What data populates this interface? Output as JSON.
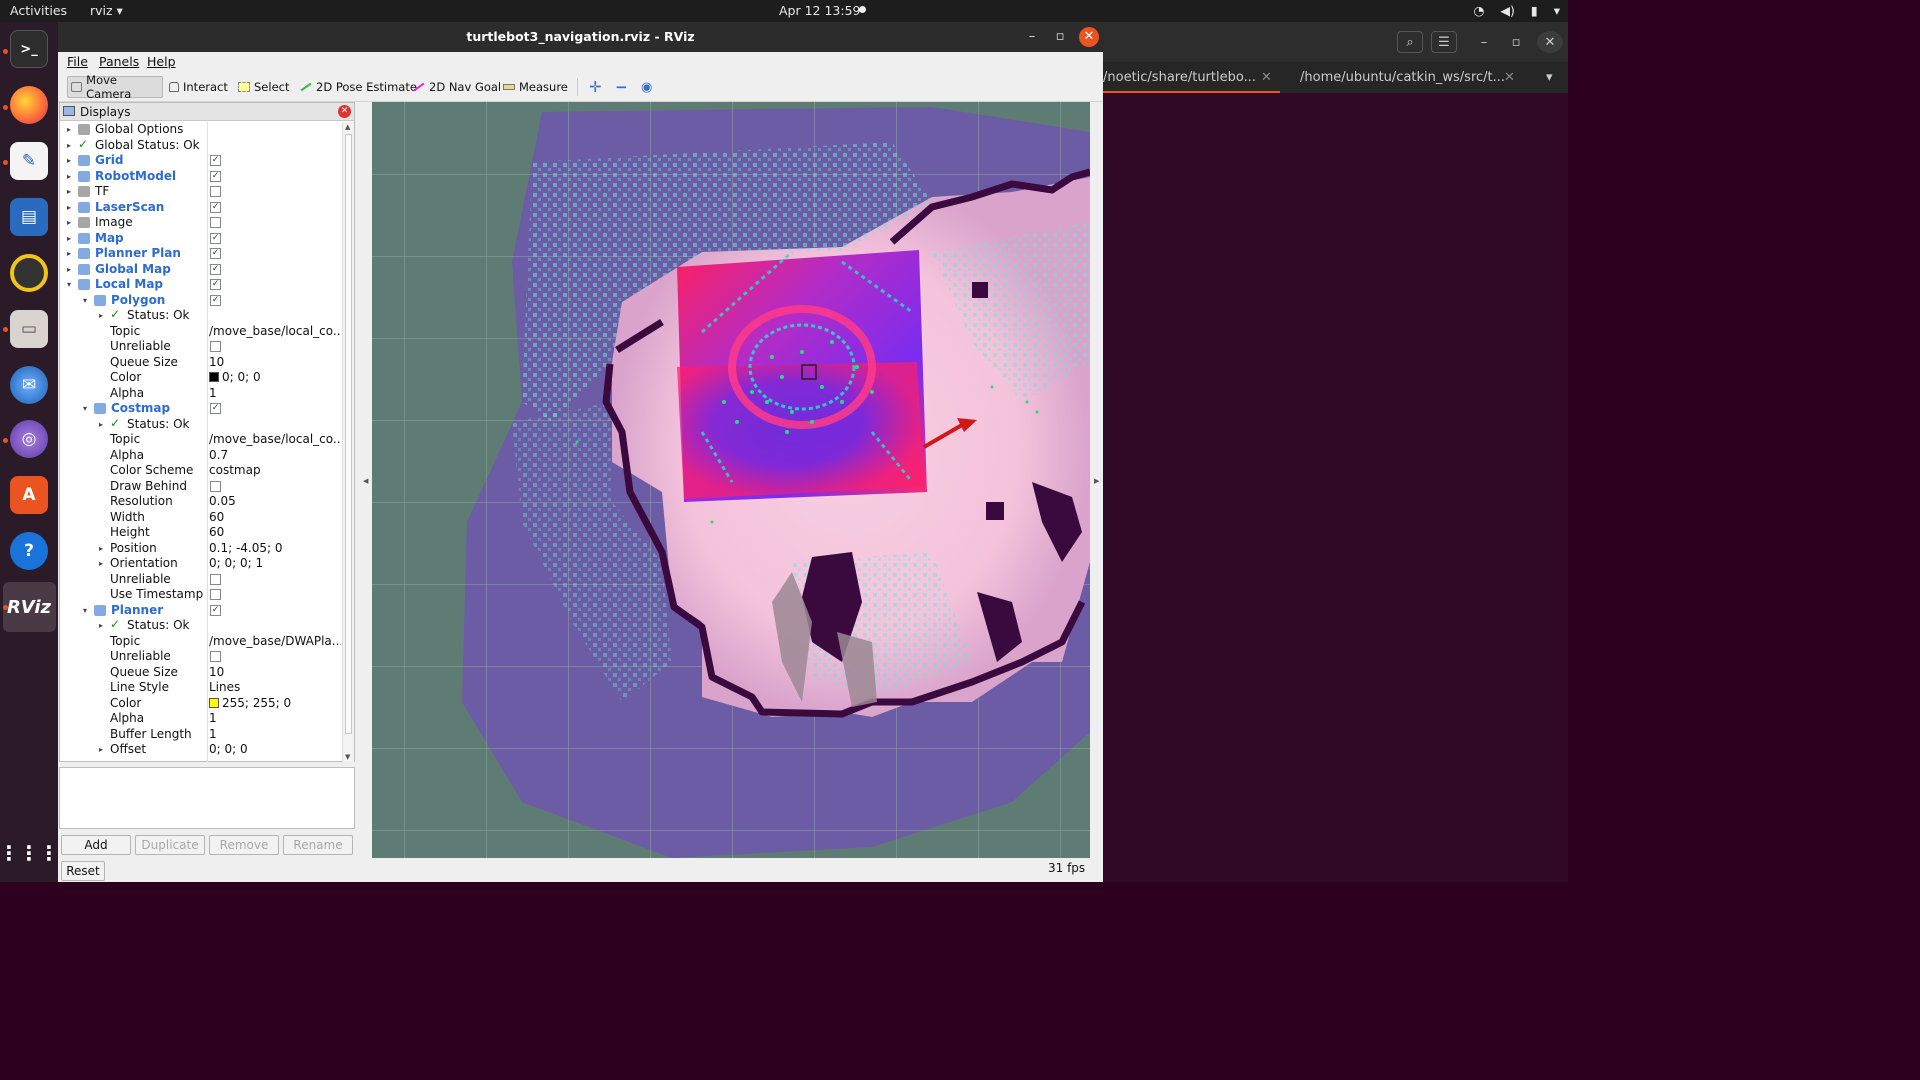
{
  "topbar": {
    "activities": "Activities",
    "app_menu": "rviz ▾",
    "clock": "Apr 12  13:59",
    "icons": [
      "wifi-icon",
      "volume-icon",
      "battery-icon",
      "power-menu-icon"
    ]
  },
  "dock": {
    "apps": [
      "terminal",
      "firefox",
      "text-editor",
      "writer",
      "rhythmbox",
      "files",
      "thunderbird",
      "network-app",
      "software-center",
      "help",
      "rviz",
      "app-grid"
    ]
  },
  "terminal": {
    "tabs": [
      "/noetic/share/turtlebo...",
      "/home/ubuntu/catkin_ws/src/t..."
    ]
  },
  "window": {
    "title": "turtlebot3_navigation.rviz - RViz",
    "close_color": "#e95420"
  },
  "menu": {
    "file": "File",
    "panels": "Panels",
    "help": "Help"
  },
  "toolbar": {
    "move_camera": "Move Camera",
    "interact": "Interact",
    "select": "Select",
    "pose_estimate": "2D Pose Estimate",
    "nav_goal": "2D Nav Goal",
    "measure": "Measure"
  },
  "displays": {
    "title": "Displays",
    "rows": [
      {
        "name": "Global Options",
        "arrow": "▸"
      },
      {
        "name": "Global Status: Ok",
        "arrow": "▸"
      },
      {
        "name": "Grid",
        "arrow": "▸",
        "plugin": true,
        "checked": true
      },
      {
        "name": "RobotModel",
        "arrow": "▸",
        "plugin": true,
        "checked": true
      },
      {
        "name": "TF",
        "arrow": "▸",
        "checked": false
      },
      {
        "name": "LaserScan",
        "arrow": "▸",
        "plugin": true,
        "checked": true
      },
      {
        "name": "Image",
        "arrow": "▸",
        "checked": false
      },
      {
        "name": "Map",
        "arrow": "▸",
        "plugin": true,
        "checked": true
      },
      {
        "name": "Planner Plan",
        "arrow": "▸",
        "plugin": true,
        "checked": true
      },
      {
        "name": "Global Map",
        "arrow": "▸",
        "plugin": true,
        "checked": true
      },
      {
        "name": "Local Map",
        "arrow": "▾",
        "plugin": true,
        "checked": true
      },
      {
        "name": "Polygon",
        "arrow": "▾",
        "plugin": true,
        "checked": true,
        "indent": 1
      },
      {
        "name": "Status: Ok",
        "arrow": "▸",
        "indent": 2
      },
      {
        "name": "Topic",
        "value": "/move_base/local_co...",
        "indent": 2
      },
      {
        "name": "Unreliable",
        "checked": false,
        "indent": 2
      },
      {
        "name": "Queue Size",
        "value": "10",
        "indent": 2
      },
      {
        "name": "Color",
        "value": "0; 0; 0",
        "swatch": "#000000",
        "indent": 2
      },
      {
        "name": "Alpha",
        "value": "1",
        "indent": 2
      },
      {
        "name": "Costmap",
        "arrow": "▾",
        "plugin": true,
        "checked": true,
        "indent": 1
      },
      {
        "name": "Status: Ok",
        "arrow": "▸",
        "indent": 2
      },
      {
        "name": "Topic",
        "value": "/move_base/local_co...",
        "indent": 2
      },
      {
        "name": "Alpha",
        "value": "0.7",
        "indent": 2
      },
      {
        "name": "Color Scheme",
        "value": "costmap",
        "indent": 2
      },
      {
        "name": "Draw Behind",
        "checked": false,
        "indent": 2
      },
      {
        "name": "Resolution",
        "value": "0.05",
        "indent": 2
      },
      {
        "name": "Width",
        "value": "60",
        "indent": 2
      },
      {
        "name": "Height",
        "value": "60",
        "indent": 2
      },
      {
        "name": "Position",
        "arrow": "▸",
        "value": "0.1; -4.05; 0",
        "indent": 2
      },
      {
        "name": "Orientation",
        "arrow": "▸",
        "value": "0; 0; 0; 1",
        "indent": 2
      },
      {
        "name": "Unreliable",
        "checked": false,
        "indent": 2
      },
      {
        "name": "Use Timestamp",
        "checked": false,
        "indent": 2
      },
      {
        "name": "Planner",
        "arrow": "▾",
        "plugin": true,
        "checked": true,
        "indent": 1
      },
      {
        "name": "Status: Ok",
        "arrow": "▸",
        "indent": 2
      },
      {
        "name": "Topic",
        "value": "/move_base/DWAPla...",
        "indent": 2
      },
      {
        "name": "Unreliable",
        "checked": false,
        "indent": 2
      },
      {
        "name": "Queue Size",
        "value": "10",
        "indent": 2
      },
      {
        "name": "Line Style",
        "value": "Lines",
        "indent": 2
      },
      {
        "name": "Color",
        "value": "255; 255; 0",
        "swatch": "#ffff00",
        "indent": 2
      },
      {
        "name": "Alpha",
        "value": "1",
        "indent": 2
      },
      {
        "name": "Buffer Length",
        "value": "1",
        "indent": 2
      },
      {
        "name": "Offset",
        "arrow": "▸",
        "value": "0; 0; 0",
        "indent": 2
      }
    ]
  },
  "buttons": {
    "add": "Add",
    "duplicate": "Duplicate",
    "remove": "Remove",
    "rename": "Rename",
    "reset": "Reset"
  },
  "view": {
    "fps": "31 fps",
    "colors": {
      "background": "#5e7c73",
      "costmap_purple": "#6c5aa8",
      "lethal": "#ff0d6e",
      "free": "#f3c6dc",
      "wall": "#3a0a3e",
      "goal_arrow": "#d01818",
      "laser": "#22e07a"
    }
  }
}
